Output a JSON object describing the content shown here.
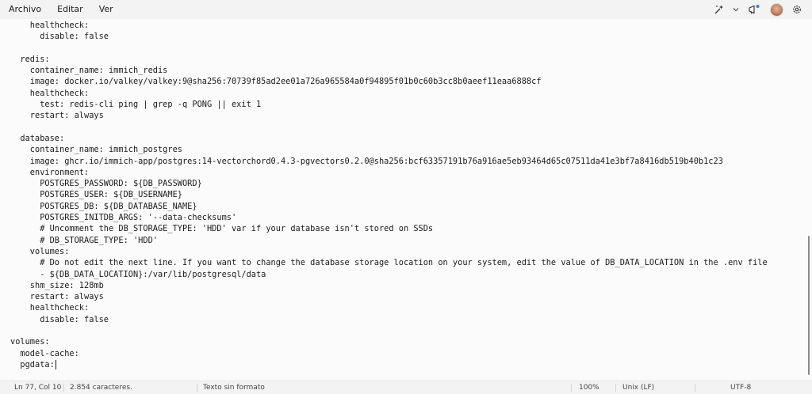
{
  "menu": {
    "items": [
      "Archivo",
      "Editar",
      "Ver"
    ]
  },
  "toolbar": {
    "icons": [
      "copilot-icon",
      "chevron-down-icon",
      "notification-icon",
      "avatar",
      "settings-icon"
    ]
  },
  "editor": {
    "lines": [
      "    healthcheck:",
      "      disable: false",
      "",
      "  redis:",
      "    container_name: immich_redis",
      "    image: docker.io/valkey/valkey:9@sha256:70739f85ad2ee01a726a965584a0f94895f01b0c60b3cc8b0aeef11eaa6888cf",
      "    healthcheck:",
      "      test: redis-cli ping | grep -q PONG || exit 1",
      "    restart: always",
      "",
      "  database:",
      "    container_name: immich_postgres",
      "    image: ghcr.io/immich-app/postgres:14-vectorchord0.4.3-pgvectors0.2.0@sha256:bcf63357191b76a916ae5eb93464d65c07511da41e3bf7a8416db519b40b1c23",
      "    environment:",
      "      POSTGRES_PASSWORD: ${DB_PASSWORD}",
      "      POSTGRES_USER: ${DB_USERNAME}",
      "      POSTGRES_DB: ${DB_DATABASE_NAME}",
      "      POSTGRES_INITDB_ARGS: '--data-checksums'",
      "      # Uncomment the DB_STORAGE_TYPE: 'HDD' var if your database isn't stored on SSDs",
      "      # DB_STORAGE_TYPE: 'HDD'",
      "    volumes:",
      "      # Do not edit the next line. If you want to change the database storage location on your system, edit the value of DB_DATA_LOCATION in the .env file",
      "      - ${DB_DATA_LOCATION}:/var/lib/postgresql/data",
      "    shm_size: 128mb",
      "    restart: always",
      "    healthcheck:",
      "      disable: false",
      "",
      "volumes:",
      "  model-cache:",
      "  pgdata:"
    ]
  },
  "status": {
    "position": "Ln 77, Col 10",
    "char_count": "2.854 caracteres.",
    "format": "Texto sin formato",
    "zoom": "100%",
    "line_ending": "Unix (LF)",
    "encoding": "UTF-8"
  }
}
